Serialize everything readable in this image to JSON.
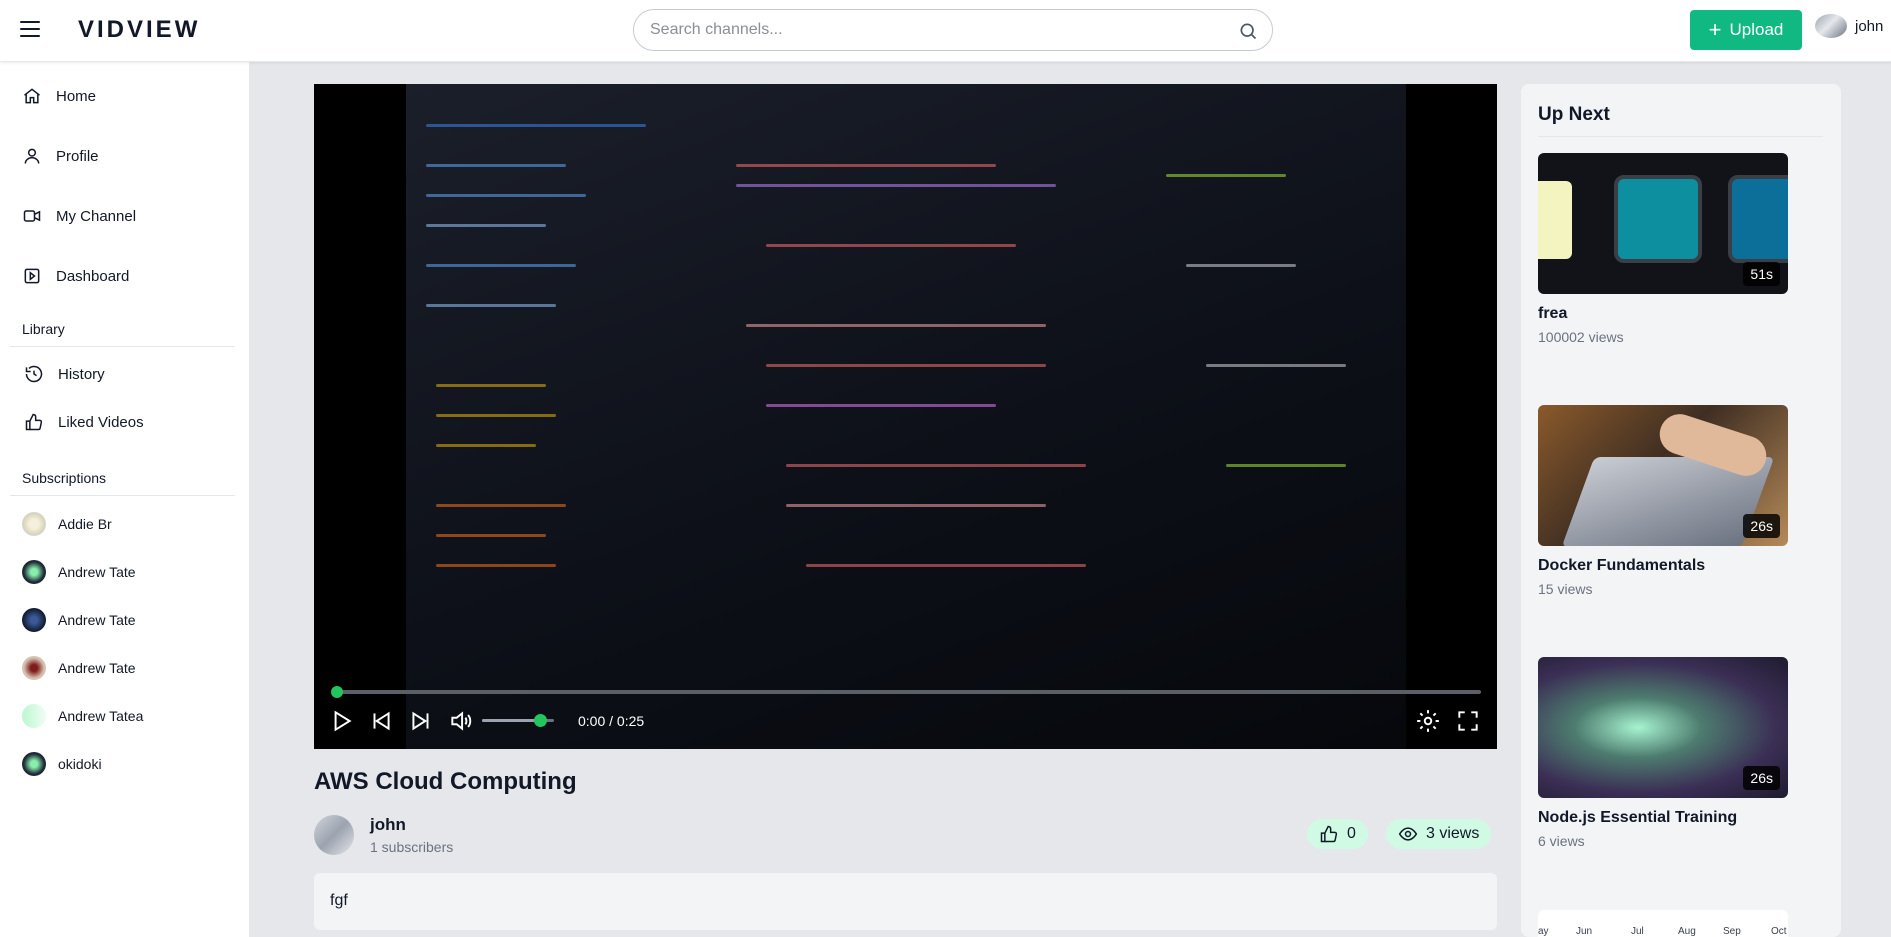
{
  "header": {
    "logo": "VIDVIEW",
    "search_placeholder": "Search channels...",
    "upload_label": "Upload",
    "username": "john"
  },
  "sidebar": {
    "nav": [
      {
        "label": "Home",
        "icon": "home-icon"
      },
      {
        "label": "Profile",
        "icon": "user-icon"
      },
      {
        "label": "My Channel",
        "icon": "video-camera-icon"
      },
      {
        "label": "Dashboard",
        "icon": "dashboard-icon"
      }
    ],
    "library_title": "Library",
    "library": [
      {
        "label": "History",
        "icon": "history-icon"
      },
      {
        "label": "Liked Videos",
        "icon": "thumbs-up-icon"
      }
    ],
    "subscriptions_title": "Subscriptions",
    "subscriptions": [
      {
        "label": "Addie Br"
      },
      {
        "label": "Andrew Tate"
      },
      {
        "label": "Andrew Tate"
      },
      {
        "label": "Andrew Tate"
      },
      {
        "label": "Andrew Tatea"
      },
      {
        "label": "okidoki"
      }
    ]
  },
  "player": {
    "time": "0:00 / 0:25",
    "progress": 0,
    "volume": 0.8,
    "accent_color": "#22c55e"
  },
  "video": {
    "title": "AWS Cloud Computing",
    "channel_name": "john",
    "subscribers": "1 subscribers",
    "likes": "0",
    "views": "3 views",
    "description": "fgf"
  },
  "upnext": {
    "title": "Up Next",
    "items": [
      {
        "title": "frea",
        "views": "100002 views",
        "duration": "51s"
      },
      {
        "title": "Docker Fundamentals",
        "views": "15 views",
        "duration": "26s"
      },
      {
        "title": "Node.js Essential Training",
        "views": "6 views",
        "duration": "26s"
      }
    ],
    "partial_thumb_labels": [
      "ay",
      "Jun",
      "Jul",
      "Aug",
      "Sep",
      "Oct"
    ]
  },
  "colors": {
    "brand": "#10b981",
    "pill": "#d1fae5"
  }
}
